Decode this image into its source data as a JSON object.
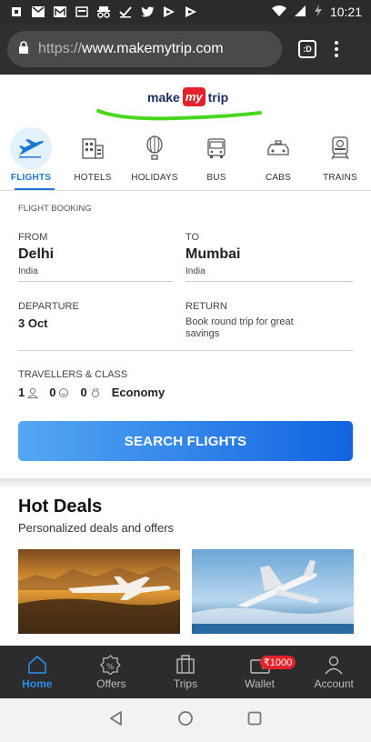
{
  "status_bar": {
    "time": "10:21",
    "icons": [
      "notification-icon",
      "mail-icon",
      "gmail-icon",
      "app-icon",
      "incognito-icon",
      "check-icon",
      "twitter-icon",
      "flipboard-icon",
      "flipboard-icon",
      "wifi-icon",
      "signal-icon",
      "battery-charging-icon"
    ]
  },
  "browser": {
    "url_scheme": "https://",
    "url_host": "www.makemytrip.com",
    "tabs_label": ":D"
  },
  "logo": {
    "make": "make",
    "my": "my",
    "trip": "trip"
  },
  "categories": [
    {
      "label": "FLIGHTS",
      "icon": "plane-icon",
      "active": true
    },
    {
      "label": "HOTELS",
      "icon": "hotel-icon",
      "active": false
    },
    {
      "label": "HOLIDAYS",
      "icon": "balloon-icon",
      "active": false
    },
    {
      "label": "BUS",
      "icon": "bus-icon",
      "active": false
    },
    {
      "label": "CABS",
      "icon": "cab-icon",
      "active": false
    },
    {
      "label": "TRAINS",
      "icon": "train-icon",
      "active": false
    }
  ],
  "booking": {
    "title": "FLIGHT BOOKING",
    "from_label": "FROM",
    "from_city": "Delhi",
    "from_country": "India",
    "to_label": "TO",
    "to_city": "Mumbai",
    "to_country": "India",
    "departure_label": "DEPARTURE",
    "departure_value": "3 Oct",
    "return_label": "RETURN",
    "return_note": "Book round trip for great savings",
    "travellers_label": "TRAVELLERS & CLASS",
    "adults": "1",
    "children": "0",
    "infants": "0",
    "class": "Economy",
    "search_button": "SEARCH FLIGHTS"
  },
  "deals": {
    "title": "Hot Deals",
    "subtitle": "Personalized deals and offers"
  },
  "bottom_nav": [
    {
      "label": "Home",
      "icon": "home-icon",
      "active": true
    },
    {
      "label": "Offers",
      "icon": "offers-icon",
      "active": false
    },
    {
      "label": "Trips",
      "icon": "trips-icon",
      "active": false
    },
    {
      "label": "Wallet",
      "icon": "wallet-icon",
      "active": false,
      "badge": "₹1000"
    },
    {
      "label": "Account",
      "icon": "account-icon",
      "active": false
    }
  ],
  "colors": {
    "accent": "#1d78d4",
    "brand_red": "#e5222b",
    "button_start": "#54a8f2",
    "button_end": "#1263e0"
  }
}
